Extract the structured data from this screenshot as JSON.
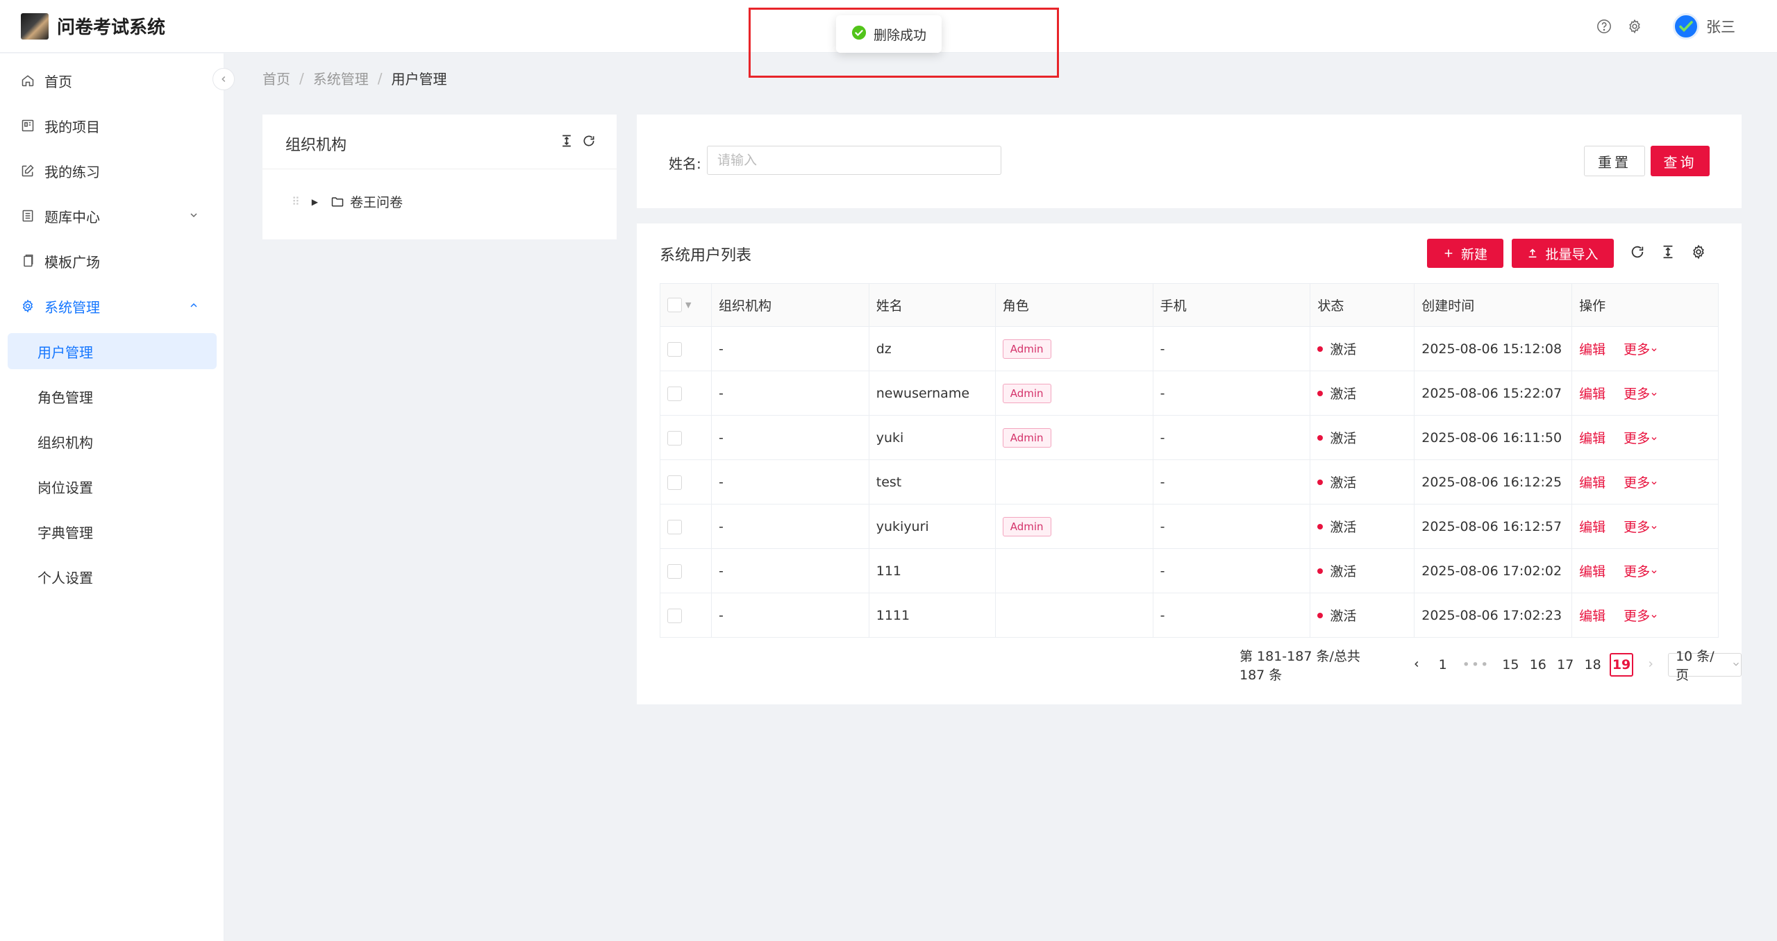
{
  "app": {
    "title": "问卷考试系统",
    "user": "张三"
  },
  "toast": {
    "message": "删除成功"
  },
  "sidebar": {
    "items": [
      {
        "label": "首页",
        "icon": "home-icon"
      },
      {
        "label": "我的项目",
        "icon": "project-icon"
      },
      {
        "label": "我的练习",
        "icon": "edit-icon"
      },
      {
        "label": "题库中心",
        "icon": "database-icon"
      },
      {
        "label": "模板广场",
        "icon": "template-icon"
      },
      {
        "label": "系统管理",
        "icon": "gear-icon"
      }
    ],
    "submenu": [
      {
        "label": "用户管理",
        "selected": true
      },
      {
        "label": "角色管理"
      },
      {
        "label": "组织机构"
      },
      {
        "label": "岗位设置"
      },
      {
        "label": "字典管理"
      },
      {
        "label": "个人设置"
      }
    ]
  },
  "breadcrumb": {
    "home": "首页",
    "section": "系统管理",
    "current": "用户管理",
    "sep": "/"
  },
  "org": {
    "title": "组织机构",
    "tree_root": "卷王问卷"
  },
  "search": {
    "label": "姓名:",
    "placeholder": "请输入",
    "reset": "重置",
    "query": "查询"
  },
  "table": {
    "title": "系统用户列表",
    "new_label": "新建",
    "import_label": "批量导入",
    "columns": [
      "组织机构",
      "姓名",
      "角色",
      "手机",
      "状态",
      "创建时间",
      "操作"
    ],
    "edit_label": "编辑",
    "more_label": "更多",
    "rows": [
      {
        "org": "-",
        "name": "dz",
        "role": "Admin",
        "phone": "-",
        "status": "激活",
        "created": "2025-08-06 15:12:08"
      },
      {
        "org": "-",
        "name": "newusername",
        "role": "Admin",
        "phone": "-",
        "status": "激活",
        "created": "2025-08-06 15:22:07"
      },
      {
        "org": "-",
        "name": "yuki",
        "role": "Admin",
        "phone": "-",
        "status": "激活",
        "created": "2025-08-06 16:11:50"
      },
      {
        "org": "-",
        "name": "test",
        "role": "",
        "phone": "-",
        "status": "激活",
        "created": "2025-08-06 16:12:25"
      },
      {
        "org": "-",
        "name": "yukiyuri",
        "role": "Admin",
        "phone": "-",
        "status": "激活",
        "created": "2025-08-06 16:12:57"
      },
      {
        "org": "-",
        "name": "111",
        "role": "",
        "phone": "-",
        "status": "激活",
        "created": "2025-08-06 17:02:02"
      },
      {
        "org": "-",
        "name": "1111",
        "role": "",
        "phone": "-",
        "status": "激活",
        "created": "2025-08-06 17:02:23"
      }
    ]
  },
  "pagination": {
    "total_text": "第 181-187 条/总共 187 条",
    "first": "1",
    "ellipsis": "•••",
    "pages": [
      "15",
      "16",
      "17",
      "18"
    ],
    "current": "19",
    "page_size": "10 条/页"
  },
  "colors": {
    "primary": "#e8123e",
    "menu_active": "#1677ff",
    "success": "#52c41a"
  }
}
